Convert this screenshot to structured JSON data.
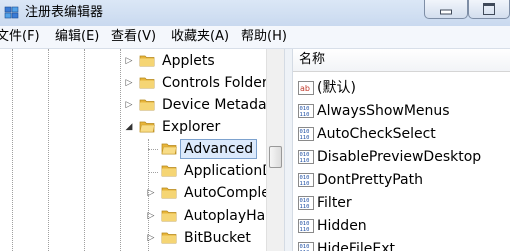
{
  "window": {
    "title": "注册表编辑器"
  },
  "menu": [
    {
      "label": "文件(F)"
    },
    {
      "label": "编辑(E)"
    },
    {
      "label": "查看(V)"
    },
    {
      "label": "收藏夹(A)"
    },
    {
      "label": "帮助(H)"
    }
  ],
  "tree": {
    "items": [
      {
        "label": "Applets",
        "expander": "▷"
      },
      {
        "label": "Controls Folder",
        "expander": "▷"
      },
      {
        "label": "Device Metadata",
        "expander": "▷"
      },
      {
        "label": "Explorer",
        "expander": "◢"
      },
      {
        "label": "Advanced",
        "expander": "",
        "selected": true
      },
      {
        "label": "ApplicationD",
        "expander": ""
      },
      {
        "label": "AutoComplet",
        "expander": "▷"
      },
      {
        "label": "AutoplayHan",
        "expander": "▷"
      },
      {
        "label": "BitBucket",
        "expander": "▷"
      }
    ]
  },
  "values": {
    "column_name": "名称",
    "items": [
      {
        "name": "(默认)",
        "icon": "string-value-icon"
      },
      {
        "name": "AlwaysShowMenus",
        "icon": "binary-value-icon"
      },
      {
        "name": "AutoCheckSelect",
        "icon": "binary-value-icon"
      },
      {
        "name": "DisablePreviewDesktop",
        "icon": "binary-value-icon"
      },
      {
        "name": "DontPrettyPath",
        "icon": "binary-value-icon"
      },
      {
        "name": "Filter",
        "icon": "binary-value-icon"
      },
      {
        "name": "Hidden",
        "icon": "binary-value-icon"
      },
      {
        "name": "HideFileExt",
        "icon": "binary-value-icon"
      }
    ]
  },
  "colors": {
    "selection_bg": "#dceafc",
    "selection_border": "#7da2ce",
    "folder": "#f2c454"
  }
}
